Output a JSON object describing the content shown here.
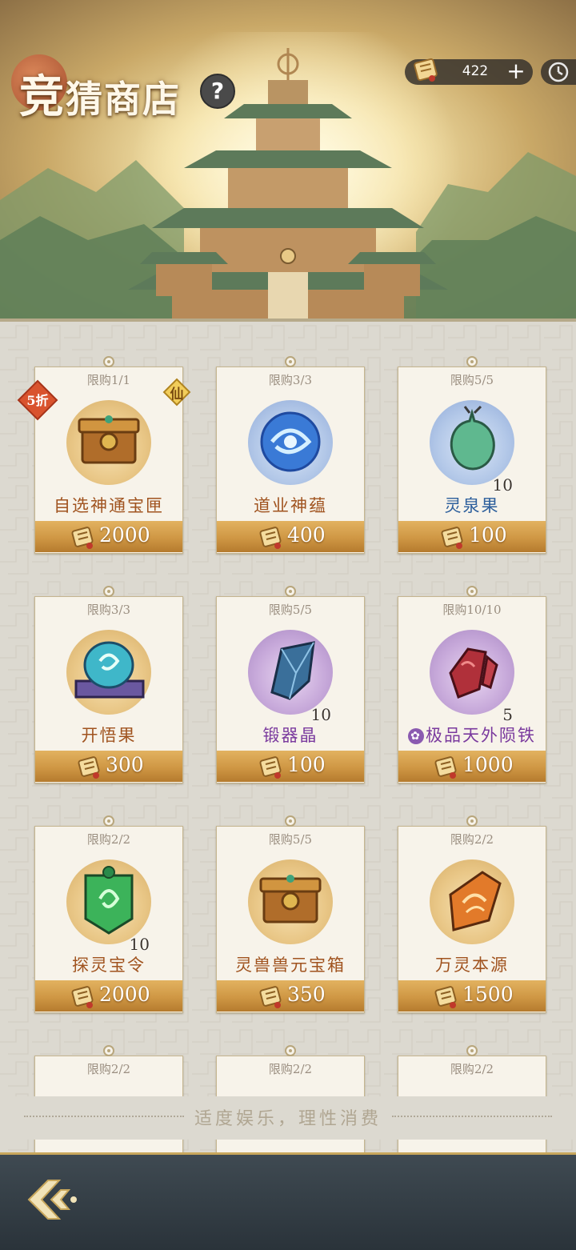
{
  "header": {
    "title_first_char": "竞",
    "title_rest": "猜商店",
    "help_label": "?",
    "currency_amount": "422",
    "currency_add": "+",
    "icons": {
      "currency": "ticket-scroll-icon",
      "clock": "clock-icon",
      "help": "question-icon"
    }
  },
  "items": [
    {
      "limit": "限购1/1",
      "name": "自选神通宝匣",
      "qty": "",
      "price": "2000",
      "name_color": "orange",
      "discount": "5折",
      "tag": "仙"
    },
    {
      "limit": "限购3/3",
      "name": "道业神蕴",
      "qty": "",
      "price": "400",
      "name_color": "orange",
      "discount": "",
      "tag": ""
    },
    {
      "limit": "限购5/5",
      "name": "灵泉果",
      "qty": "10",
      "price": "100",
      "name_color": "blue",
      "discount": "",
      "tag": ""
    },
    {
      "limit": "限购3/3",
      "name": "开悟果",
      "qty": "",
      "price": "300",
      "name_color": "orange",
      "discount": "",
      "tag": ""
    },
    {
      "limit": "限购5/5",
      "name": "锻器晶",
      "qty": "10",
      "price": "100",
      "name_color": "purple",
      "discount": "",
      "tag": ""
    },
    {
      "limit": "限购10/10",
      "name": "极品天外陨铁",
      "qty": "5",
      "price": "1000",
      "name_color": "purple",
      "discount": "",
      "tag": ""
    },
    {
      "limit": "限购2/2",
      "name": "探灵宝令",
      "qty": "10",
      "price": "2000",
      "name_color": "orange",
      "discount": "",
      "tag": ""
    },
    {
      "limit": "限购5/5",
      "name": "灵兽兽元宝箱",
      "qty": "",
      "price": "350",
      "name_color": "orange",
      "discount": "",
      "tag": ""
    },
    {
      "limit": "限购2/2",
      "name": "万灵本源",
      "qty": "",
      "price": "1500",
      "name_color": "orange",
      "discount": "",
      "tag": ""
    },
    {
      "limit": "限购2/2"
    },
    {
      "limit": "限购2/2"
    },
    {
      "limit": "限购2/2"
    }
  ],
  "footer": {
    "notice": "适度娱乐，理性消费"
  },
  "colors": {
    "accent_gold": "#cf9744",
    "name_orange": "#a0531f",
    "name_blue": "#2d5f9c",
    "name_purple": "#7a3a9e"
  }
}
